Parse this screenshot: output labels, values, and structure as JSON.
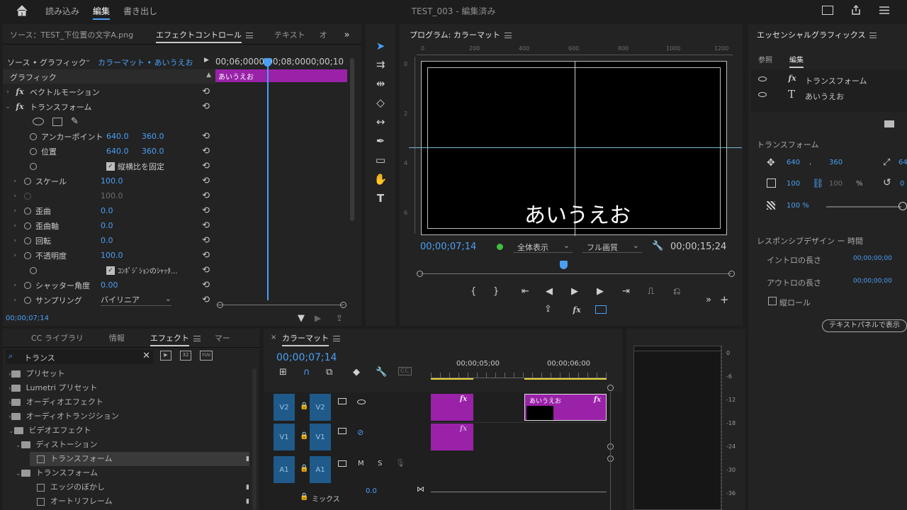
{
  "topbar": {
    "home_icon": "home-icon",
    "import_label": "読み込み",
    "edit_label": "編集",
    "export_label": "書き出し",
    "title": "TEST_003 - 編集済み"
  },
  "effect_panel": {
    "tabs": [
      "ソース：TEST_下位置の文字A.png",
      "エフェクトコントロール",
      "テキスト",
      "オ"
    ],
    "source_label": "ソース • グラフィック",
    "clip_label": "カラーマット • あいうえお",
    "ruler_times": "00;06;0000;00;08;0000;00;10",
    "clip_name": "あいうえお",
    "section": "グラフィック",
    "rows": [
      {
        "name": "ベクトルモーション"
      },
      {
        "name": "トランスフォーム"
      },
      {
        "name": "アンカーポイント",
        "v1": "640.0",
        "v2": "360.0"
      },
      {
        "name": "位置",
        "v1": "640.0",
        "v2": "360.0"
      },
      {
        "name": "縦横比を固定"
      },
      {
        "name": "スケール",
        "v1": "100.0"
      },
      {
        "name": "",
        "v1": "100.0"
      },
      {
        "name": "歪曲",
        "v1": "0.0"
      },
      {
        "name": "歪曲軸",
        "v1": "0.0"
      },
      {
        "name": "回転",
        "v1": "0.0"
      },
      {
        "name": "不透明度",
        "v1": "100.0"
      },
      {
        "name": "ｺﾝﾎﾟｼﾞｼｮﾝのｼｬｯﾀ..."
      },
      {
        "name": "シャッター角度",
        "v1": "0.00"
      },
      {
        "name": "サンプリング",
        "v1": "バイリニア"
      }
    ],
    "timecode": "00;00;07;14"
  },
  "program": {
    "title": "プログラム: カラーマット",
    "ruler": [
      "0",
      "200",
      "400",
      "600",
      "800",
      "1000",
      "1200"
    ],
    "vruler": [
      "0",
      "2",
      "4",
      "6"
    ],
    "canvas_text": "あいうえお",
    "timecode": "00;00;07;14",
    "fit": "全体表示",
    "quality": "フル画質",
    "duration": "00;00;15;24",
    "playhead_fraction": 0.46
  },
  "essential": {
    "title": "エッセンシャルグラフィックス",
    "tab_browse": "参照",
    "tab_edit": "編集",
    "layers": [
      {
        "icon": "fx-icon",
        "label": "トランスフォーム"
      },
      {
        "icon": "text-icon",
        "label": "あいうえお"
      }
    ],
    "transform_title": "トランスフォーム",
    "pos_x": "640",
    "pos_y": "360",
    "scale": "100",
    "scale_dim": "100",
    "pct": "%",
    "rot": "0",
    "opacity": "100 %",
    "anchor": "64",
    "responsive_title": "レスポンシブデザイン ー 時間",
    "intro_label": "イントロの長さ",
    "intro_value": "00;00;00;00",
    "outro_label": "アウトロの長さ",
    "outro_value": "00;00;00;00",
    "roll_label": "縦ロール",
    "text_panel_btn": "テキストパネルで表示"
  },
  "project": {
    "tabs": [
      "CC ライブラリ",
      "情報",
      "エフェクト",
      "マー"
    ],
    "search": "トランス",
    "items": [
      {
        "label": "プリセット",
        "depth": 0
      },
      {
        "label": "Lumetri プリセット",
        "depth": 0
      },
      {
        "label": "オーディオエフェクト",
        "depth": 0
      },
      {
        "label": "オーディオトランジション",
        "depth": 0
      },
      {
        "label": "ビデオエフェクト",
        "depth": 0
      },
      {
        "label": "ディストーション",
        "depth": 1
      },
      {
        "label": "トランスフォーム",
        "depth": 2
      },
      {
        "label": "トランスフォーム",
        "depth": 1
      },
      {
        "label": "エッジのぼかし",
        "depth": 2
      },
      {
        "label": "オートリフレーム",
        "depth": 2
      }
    ]
  },
  "timeline": {
    "tab": "カラーマット",
    "timecode": "00;00;07;14",
    "time1": "00;00;05;00",
    "time2": "00;00;06;00",
    "v2": "V2",
    "v1": "V1",
    "a1": "A1",
    "m": "M",
    "s": "S",
    "mix_label": "ミックス",
    "mix_value": "0.0",
    "clip_label": "あいうえお"
  },
  "meter": {
    "scale": [
      "0",
      "-6",
      "-12",
      "-18",
      "-24",
      "-30",
      "-36"
    ]
  },
  "colors": {
    "accent": "#4a9ff5",
    "clip": "#9a22a8",
    "track": "#1f5a8a"
  }
}
